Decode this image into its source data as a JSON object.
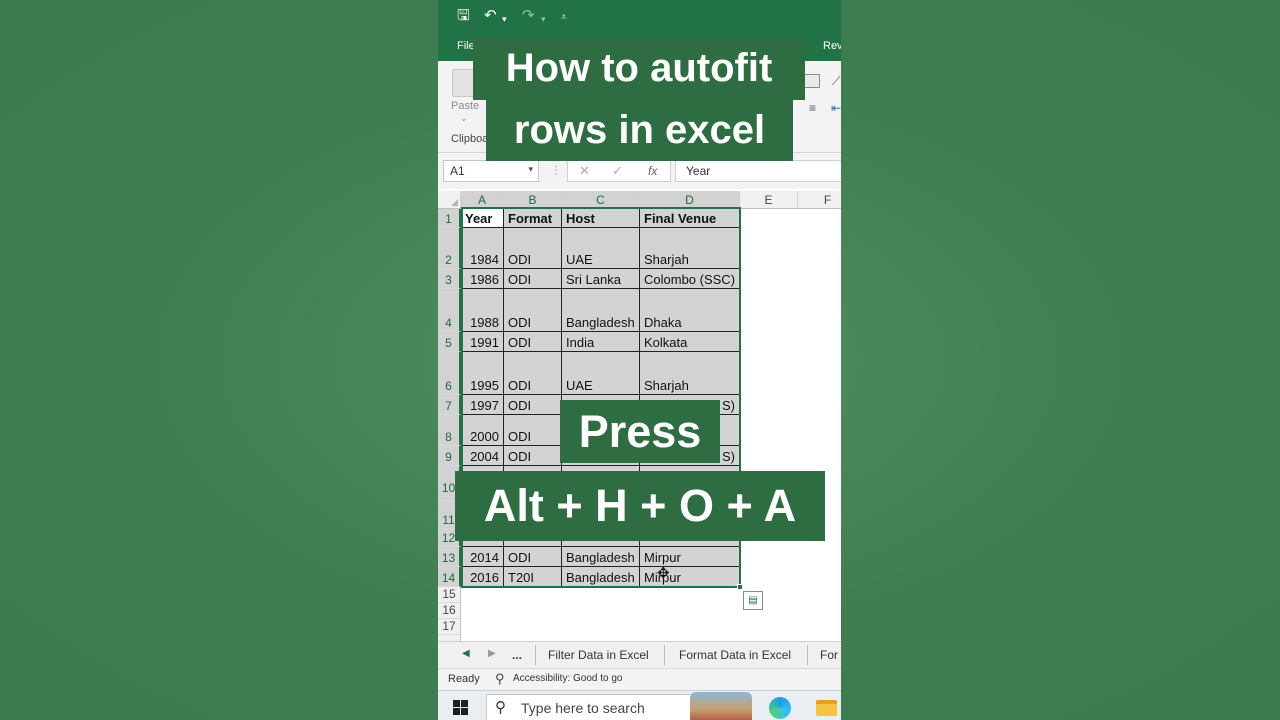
{
  "app": {
    "tabs": {
      "file": "File",
      "review": "Rev"
    },
    "clipboard": {
      "paste_label": "Paste",
      "group_label": "Clipboa"
    }
  },
  "formula_bar": {
    "name_box": "A1",
    "fx": "fx",
    "value": "Year"
  },
  "sheet": {
    "columns": [
      "A",
      "B",
      "C",
      "D",
      "E",
      "F"
    ],
    "row_numbers": [
      "1",
      "2",
      "3",
      "4",
      "5",
      "6",
      "7",
      "8",
      "9",
      "10",
      "11",
      "12",
      "13",
      "14",
      "15",
      "16",
      "17"
    ],
    "header": [
      "Year",
      "Format",
      "Host",
      "Final Venue"
    ],
    "rows": [
      [
        "1984",
        "ODI",
        "UAE",
        "Sharjah"
      ],
      [
        "1986",
        "ODI",
        "Sri Lanka",
        "Colombo (SSC)"
      ],
      [
        "1988",
        "ODI",
        "Bangladesh",
        "Dhaka"
      ],
      [
        "1991",
        "ODI",
        "India",
        "Kolkata"
      ],
      [
        "1995",
        "ODI",
        "UAE",
        "Sharjah"
      ],
      [
        "1997",
        "ODI",
        "",
        "S)"
      ],
      [
        "2000",
        "ODI",
        "",
        ""
      ],
      [
        "2004",
        "ODI",
        "",
        "S)"
      ],
      [
        "",
        "",
        "",
        ""
      ],
      [
        "",
        "",
        "",
        ""
      ],
      [
        "",
        "",
        "",
        ""
      ],
      [
        "2014",
        "ODI",
        "Bangladesh",
        "Mirpur"
      ],
      [
        "2016",
        "T20I",
        "Bangladesh",
        "Mirpur"
      ]
    ]
  },
  "sheet_tabs": {
    "more": "...",
    "tab1": "Filter Data in Excel",
    "tab2": "Format Data in Excel",
    "tab3": "For"
  },
  "status": {
    "ready": "Ready",
    "accessibility": "Accessibility: Good to go"
  },
  "taskbar": {
    "search_placeholder": "Type here to search"
  },
  "overlay": {
    "title_line1": "How to autofit",
    "title_line2": "rows in excel",
    "press": "Press",
    "keys": "Alt + H + O + A"
  }
}
